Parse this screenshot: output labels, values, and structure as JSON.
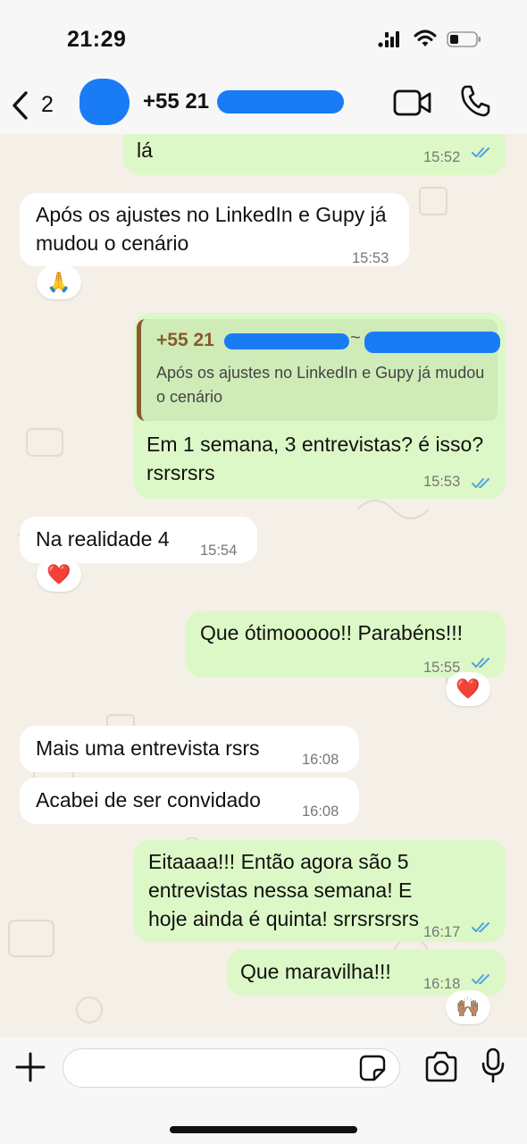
{
  "status_bar": {
    "time": "21:29"
  },
  "header": {
    "back_count": "2",
    "contact_name": "+55 21"
  },
  "messages": [
    {
      "id": "m1",
      "direction": "out",
      "text": "lá",
      "time": "15:52",
      "read": true
    },
    {
      "id": "m2",
      "direction": "in",
      "text": "Após os ajustes no LinkedIn e Gupy já mudou o cenário",
      "time": "15:53",
      "reaction": "🙏"
    },
    {
      "id": "m3",
      "direction": "out",
      "quote_name": "+55 21",
      "quote_tilde": "~",
      "quote_text": "Após os ajustes no LinkedIn e Gupy já mudou o cenário",
      "text": "Em 1 semana, 3 entrevistas? é isso? rsrsrsrs",
      "time": "15:53",
      "read": true
    },
    {
      "id": "m4",
      "direction": "in",
      "text": "Na realidade 4",
      "time": "15:54",
      "reaction": "❤️"
    },
    {
      "id": "m5",
      "direction": "out",
      "text": "Que ótimooooo!! Parabéns!!!",
      "time": "15:55",
      "read": true,
      "reaction": "❤️"
    },
    {
      "id": "m6",
      "direction": "in",
      "text": "Mais uma entrevista rsrs",
      "time": "16:08"
    },
    {
      "id": "m7",
      "direction": "in",
      "text": "Acabei de ser convidado",
      "time": "16:08"
    },
    {
      "id": "m8",
      "direction": "out",
      "text": "Eitaaaa!!! Então agora são 5 entrevistas nessa semana! E hoje ainda é quinta! srrsrsrsrs",
      "time": "16:17",
      "read": true
    },
    {
      "id": "m9",
      "direction": "out",
      "text": "Que maravilha!!!",
      "time": "16:18",
      "read": true,
      "reaction": "🙌🏽"
    }
  ],
  "input": {
    "value": "",
    "placeholder": ""
  },
  "icons": {
    "back": "chevron-left-icon",
    "video": "video-camera-icon",
    "call": "phone-icon",
    "plus": "plus-icon",
    "sticker": "sticker-icon",
    "camera": "camera-icon",
    "mic": "microphone-icon"
  },
  "colors": {
    "outgoing_bubble": "#dcf8c6",
    "incoming_bubble": "#ffffff",
    "read_ticks": "#4fa3e0",
    "quote_author": "#8b5a2b",
    "chat_background": "#f4efe7"
  }
}
